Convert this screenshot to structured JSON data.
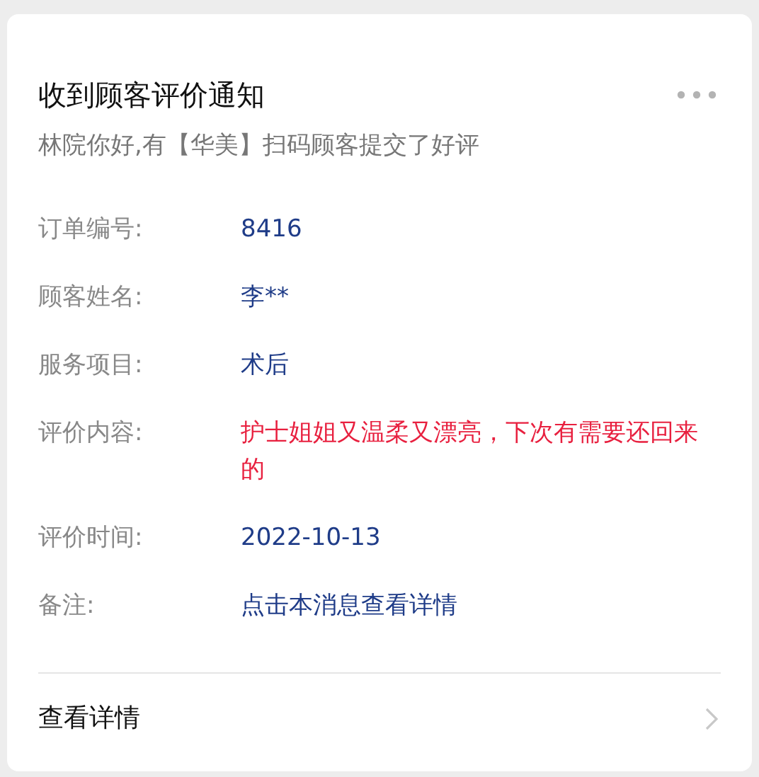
{
  "card": {
    "title": "收到顾客评价通知",
    "subtitle": "林院你好,有【华美】扫码顾客提交了好评",
    "rows": [
      {
        "label": "订单编号:",
        "value": "8416",
        "kind": "normal"
      },
      {
        "label": "顾客姓名:",
        "value": "李**",
        "kind": "normal"
      },
      {
        "label": "服务项目:",
        "value": "术后",
        "kind": "normal"
      },
      {
        "label": "评价内容:",
        "value": "护士姐姐又温柔又漂亮，下次有需要还回来的",
        "kind": "highlight"
      },
      {
        "label": "评价时间:",
        "value": "2022-10-13",
        "kind": "normal"
      },
      {
        "label": "备注:",
        "value": "点击本消息查看详情",
        "kind": "normal"
      }
    ],
    "footer": {
      "label": "查看详情"
    }
  }
}
